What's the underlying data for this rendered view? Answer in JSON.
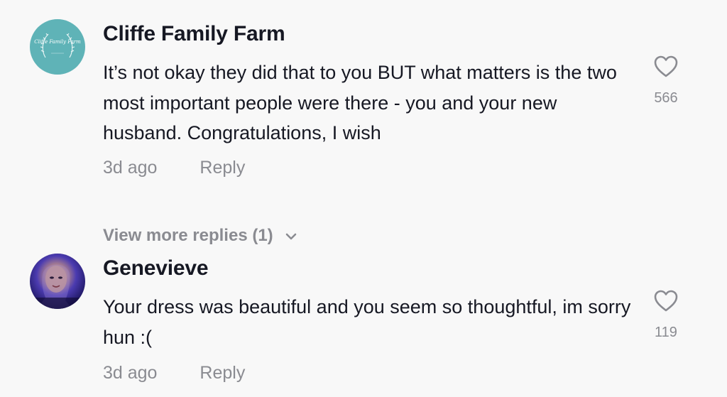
{
  "comments": [
    {
      "username": "Cliffe Family Farm",
      "avatar_icon": "cliffe-family-farm-logo",
      "avatar_logo_text": "Cliffe Family Farm",
      "text": "It’s not okay they did that to you BUT what matters is the two most important people were there - you and your new husband. Congratulations, I wish",
      "time": "3d ago",
      "reply_label": "Reply",
      "like_count": "566",
      "view_more_label": "View more replies (1)"
    },
    {
      "username": "Genevieve",
      "avatar_icon": "user-photo",
      "text": "Your dress was beautiful and you seem so thoughtful, im sorry hun :(",
      "time": "3d ago",
      "reply_label": "Reply",
      "like_count": "119"
    }
  ],
  "colors": {
    "background": "#f8f8f8",
    "primary_text": "#161823",
    "secondary_text": "#8a8b91",
    "farm_avatar": "#5fb3b7"
  },
  "icons": {
    "like": "heart-outline-icon",
    "expand": "chevron-down-icon"
  }
}
